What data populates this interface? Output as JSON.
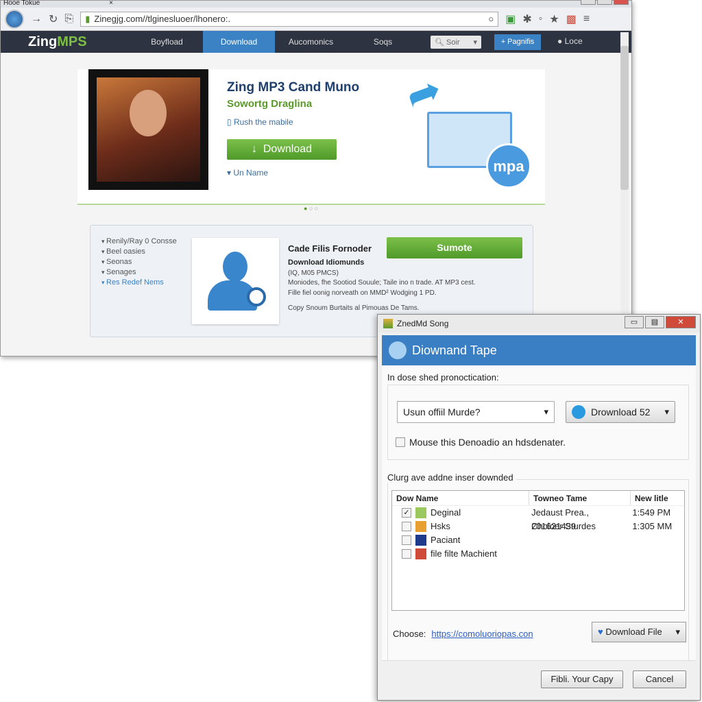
{
  "browser": {
    "tab_title": "Hooe Tokue",
    "url": "Zinegjg.com//tlginesluoer/lhonero:.",
    "logo_a": "Zing",
    "logo_b": "MPS",
    "nav": [
      "Boyfload",
      "Download",
      "Aucomonics",
      "Soqs"
    ],
    "search_placeholder": "Soir",
    "favorites": "+ Pagnifis",
    "user": "Loce"
  },
  "hero": {
    "title": "Zing MP3 Cand Muno",
    "subtitle": "Sowortg Draglina",
    "push": "Rush the mabile",
    "download": "Download",
    "unname": "Un Name",
    "badge": "mpa"
  },
  "card": {
    "side": [
      "Renily/Ray 0 Consse",
      "Beel oasies",
      "Seonas",
      "Senages",
      "Res Redef Nems"
    ],
    "title": "Cade Filis Fornoder",
    "subtitle": "Download Idiomunds",
    "lines": [
      "(IQ, M05 PMCS)",
      "Moniodes, fhe Sootiod Souule; Taile ino n trade. AT MP3 cest.",
      "Fille fiel oonig norveath on MMD² Wodging 1 PD.",
      "Copy Snoum Burtaits al Pimouas De Tams."
    ],
    "submit": "Sumote"
  },
  "dialog": {
    "window_title": "ZnedMd Song",
    "header": "Diownand Tape",
    "group1_label": "In dose shed pronoctication:",
    "select_value": "Usun offiil Murde?",
    "download_btn": "Drownload 52",
    "checkbox_label": "Mouse this Denoadio an hdsdenater.",
    "checkbox_checked": false,
    "group2_label": "Clurg ave addne inser downded",
    "columns": [
      "Dow Name",
      "Towneo Tame",
      "New litle"
    ],
    "rows": [
      {
        "name": "Deginal",
        "checked": true,
        "col2": "Jedaust Prea., 201621439",
        "col3": "1:549 PM",
        "icon_color": "#9cc860"
      },
      {
        "name": "Hsks",
        "checked": false,
        "col2": "Choloer Sturdes",
        "col3": "1:305 MM",
        "icon_color": "#e8a030"
      },
      {
        "name": "Paciant",
        "checked": false,
        "col2": "",
        "col3": "",
        "icon_color": "#1e3a8a"
      },
      {
        "name": "file filte Machient",
        "checked": false,
        "col2": "",
        "col3": "",
        "icon_color": "#d04a3a"
      }
    ],
    "choose_label": "Choose:",
    "choose_link": "https://comoluoriopas.con",
    "download_file": "Download File",
    "ok": "Fibli. Your Capy",
    "cancel": "Cancel"
  }
}
